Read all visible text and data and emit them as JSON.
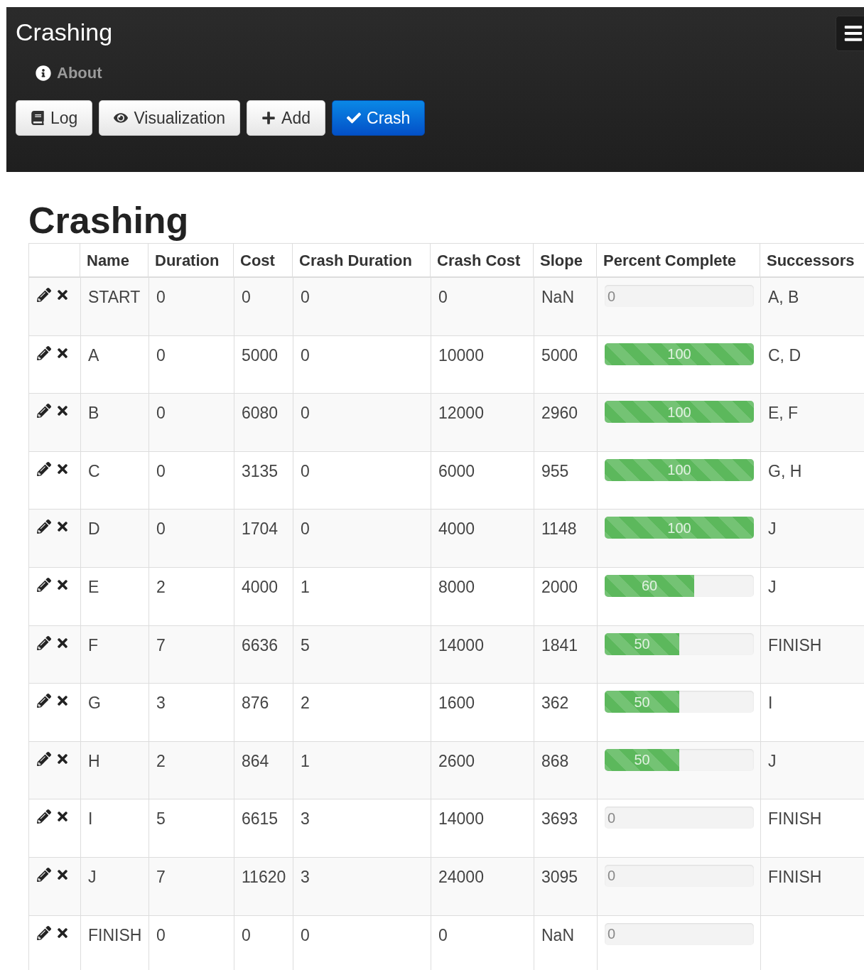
{
  "navbar": {
    "brand": "Crashing",
    "links": [
      {
        "label": "About"
      }
    ],
    "buttons": [
      {
        "label": "Log",
        "kind": "default"
      },
      {
        "label": "Visualization",
        "kind": "default"
      },
      {
        "label": "Add",
        "kind": "default"
      },
      {
        "label": "Crash",
        "kind": "primary"
      }
    ]
  },
  "heading": "Crashing",
  "table": {
    "columns": [
      "Name",
      "Duration",
      "Cost",
      "Crash Duration",
      "Crash Cost",
      "Slope",
      "Percent Complete",
      "Successors"
    ],
    "rows": [
      {
        "name": "START",
        "duration": "0",
        "cost": "0",
        "crash_duration": "0",
        "crash_cost": "0",
        "slope": "NaN",
        "percent": {
          "level": 0,
          "label": "0"
        },
        "successors": "A, B"
      },
      {
        "name": "A",
        "duration": "0",
        "cost": "5000",
        "crash_duration": "0",
        "crash_cost": "10000",
        "slope": "5000",
        "percent": {
          "level": 1,
          "label": "100"
        },
        "successors": "C, D"
      },
      {
        "name": "B",
        "duration": "0",
        "cost": "6080",
        "crash_duration": "0",
        "crash_cost": "12000",
        "slope": "2960",
        "percent": {
          "level": 1,
          "label": "100"
        },
        "successors": "E, F"
      },
      {
        "name": "C",
        "duration": "0",
        "cost": "3135",
        "crash_duration": "0",
        "crash_cost": "6000",
        "slope": "955",
        "percent": {
          "level": 1,
          "label": "100"
        },
        "successors": "G, H"
      },
      {
        "name": "D",
        "duration": "0",
        "cost": "1704",
        "crash_duration": "0",
        "crash_cost": "4000",
        "slope": "1148",
        "percent": {
          "level": 1,
          "label": "100"
        },
        "successors": "J"
      },
      {
        "name": "E",
        "duration": "2",
        "cost": "4000",
        "crash_duration": "1",
        "crash_cost": "8000",
        "slope": "2000",
        "percent": {
          "level": 0.6,
          "label": "60"
        },
        "successors": "J"
      },
      {
        "name": "F",
        "duration": "7",
        "cost": "6636",
        "crash_duration": "5",
        "crash_cost": "14000",
        "slope": "1841",
        "percent": {
          "level": 0.5,
          "label": "50"
        },
        "successors": "FINISH"
      },
      {
        "name": "G",
        "duration": "3",
        "cost": "876",
        "crash_duration": "2",
        "crash_cost": "1600",
        "slope": "362",
        "percent": {
          "level": 0.5,
          "label": "50"
        },
        "successors": "I"
      },
      {
        "name": "H",
        "duration": "2",
        "cost": "864",
        "crash_duration": "1",
        "crash_cost": "2600",
        "slope": "868",
        "percent": {
          "level": 0.5,
          "label": "50"
        },
        "successors": "J"
      },
      {
        "name": "I",
        "duration": "5",
        "cost": "6615",
        "crash_duration": "3",
        "crash_cost": "14000",
        "slope": "3693",
        "percent": {
          "level": 0,
          "label": "0"
        },
        "successors": "FINISH"
      },
      {
        "name": "J",
        "duration": "7",
        "cost": "11620",
        "crash_duration": "3",
        "crash_cost": "24000",
        "slope": "3095",
        "percent": {
          "level": 0,
          "label": "0"
        },
        "successors": "FINISH"
      },
      {
        "name": "FINISH",
        "duration": "0",
        "cost": "0",
        "crash_duration": "0",
        "crash_cost": "0",
        "slope": "NaN",
        "percent": {
          "level": 0,
          "label": "0"
        }
      }
    ]
  }
}
